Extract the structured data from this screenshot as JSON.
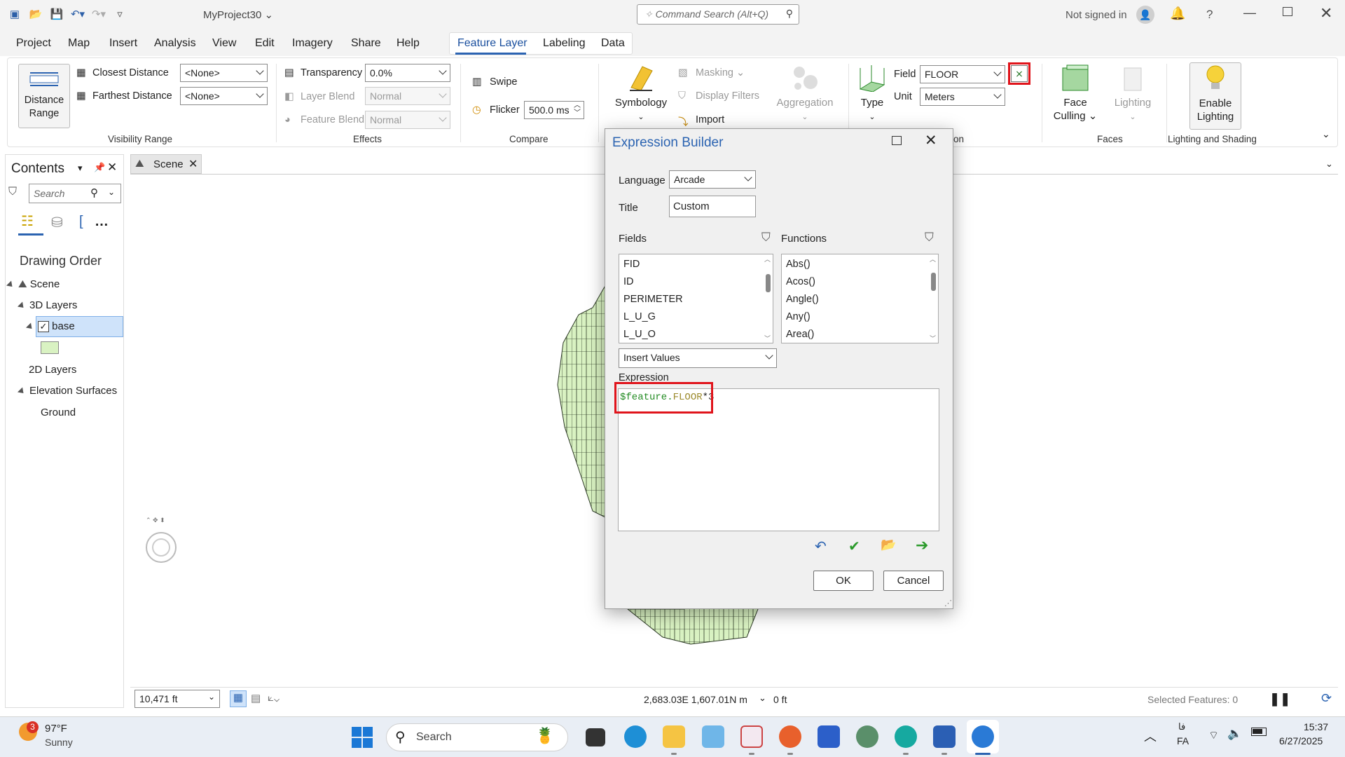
{
  "titlebar": {
    "project_name": "MyProject30",
    "command_search_placeholder": "Command Search (Alt+Q)",
    "signed_in_status": "Not signed in",
    "help_label": "?"
  },
  "menu": {
    "items": [
      "Project",
      "Map",
      "Insert",
      "Analysis",
      "View",
      "Edit",
      "Imagery",
      "Share",
      "Help"
    ],
    "contextual_tabs": [
      "Feature Layer",
      "Labeling",
      "Data"
    ],
    "active_tab": "Feature Layer"
  },
  "ribbon": {
    "distance_range_label": "Distance Range",
    "closest_distance_label": "Closest Distance",
    "closest_distance_value": "<None>",
    "farthest_distance_label": "Farthest Distance",
    "farthest_distance_value": "<None>",
    "visibility_range_group": "Visibility Range",
    "transparency_label": "Transparency",
    "transparency_value": "0.0%",
    "layer_blend_label": "Layer Blend",
    "layer_blend_value": "Normal",
    "feature_blend_label": "Feature Blend",
    "feature_blend_value": "Normal",
    "effects_group": "Effects",
    "swipe_label": "Swipe",
    "flicker_label": "Flicker",
    "flicker_value": "500.0",
    "flicker_unit": "ms",
    "compare_group": "Compare",
    "symbology_label": "Symbology",
    "masking_label": "Masking",
    "display_filters_label": "Display Filters",
    "import_label": "Import",
    "aggregation_label": "Aggregation",
    "type_label": "Type",
    "field_label": "Field",
    "field_value": "FLOOR",
    "unit_label": "Unit",
    "unit_value": "Meters",
    "extrusion_group_fragment": "on",
    "face_culling_label": "Face Culling",
    "lighting_label": "Lighting",
    "faces_group": "Faces",
    "enable_lighting_label": "Enable Lighting",
    "lighting_shading_group": "Lighting and Shading"
  },
  "contents": {
    "title": "Contents",
    "search_placeholder": "Search",
    "drawing_order": "Drawing Order",
    "tree": {
      "scene": "Scene",
      "layers_3d": "3D Layers",
      "base": "base",
      "layers_2d": "2D Layers",
      "elevation_surfaces": "Elevation Surfaces",
      "ground": "Ground"
    },
    "base_swatch_color": "#d9f2c2"
  },
  "map": {
    "tab_label": "Scene",
    "scale_value": "10,471 ft",
    "coordinates": "2,683.03E 1,607.01N m",
    "elevation": "0 ft",
    "selected_features": "Selected Features: 0"
  },
  "dialog": {
    "title": "Expression Builder",
    "language_label": "Language",
    "language_value": "Arcade",
    "title_label": "Title",
    "title_value": "Custom",
    "fields_label": "Fields",
    "fields": [
      "FID",
      "ID",
      "PERIMETER",
      "L_U_G",
      "L_U_O"
    ],
    "functions_label": "Functions",
    "functions": [
      "Abs()",
      "Acos()",
      "Angle()",
      "Any()",
      "Area()"
    ],
    "insert_values_label": "Insert Values",
    "expression_label": "Expression",
    "expression_part1": "$feature.",
    "expression_part2": "FLOOR",
    "expression_part3": "*3",
    "ok_label": "OK",
    "cancel_label": "Cancel"
  },
  "taskbar": {
    "weather_temp": "97°F",
    "weather_condition": "Sunny",
    "weather_badge": "3",
    "search_label": "Search",
    "lang_top": "فا",
    "lang_bottom": "FA",
    "time": "15:37",
    "date": "6/27/2025"
  },
  "colors": {
    "accent": "#2b63b1",
    "highlight_red": "#e0141b",
    "feature_fill": "#d9f2c2",
    "selection_blue": "#cfe3fa"
  }
}
